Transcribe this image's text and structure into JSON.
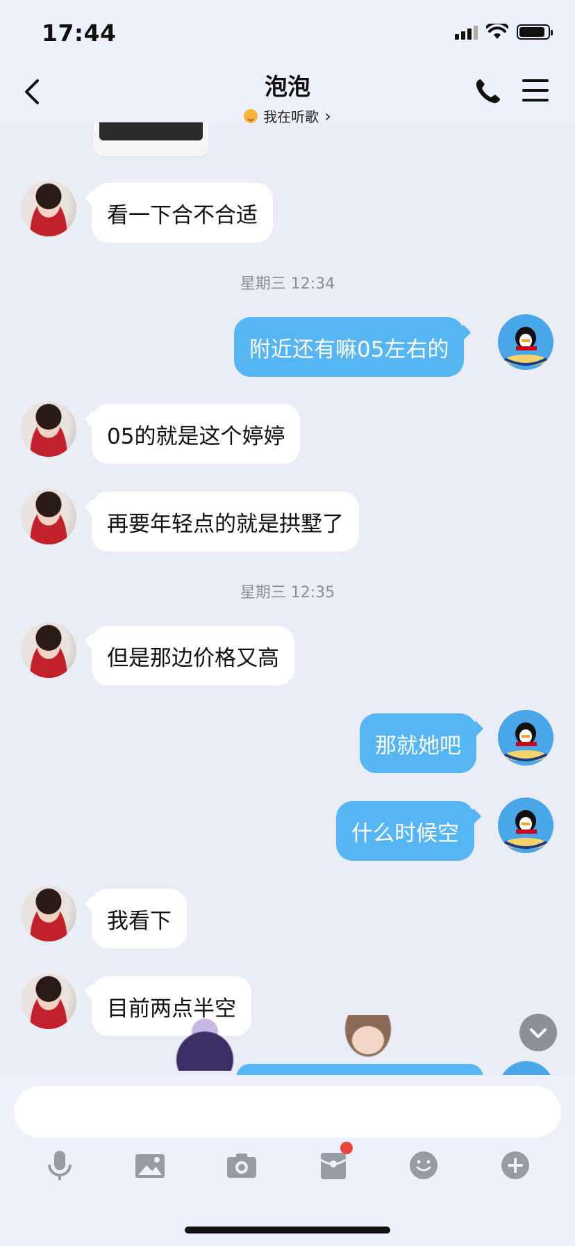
{
  "status_bar": {
    "time": "17:44"
  },
  "header": {
    "title": "泡泡",
    "status_text": "我在听歌",
    "chevron": "›"
  },
  "messages": [
    {
      "side": "in",
      "text": "看一下合不合适"
    },
    {
      "timestamp": "星期三 12:34"
    },
    {
      "side": "out",
      "text": "附近还有嘛05左右的"
    },
    {
      "side": "in",
      "text": "05的就是这个婷婷"
    },
    {
      "side": "in",
      "text": "再要年轻点的就是拱墅了"
    },
    {
      "timestamp": "星期三 12:35"
    },
    {
      "side": "in",
      "text": "但是那边价格又高"
    },
    {
      "side": "out",
      "text": "那就她吧"
    },
    {
      "side": "out",
      "text": "什么时候空"
    },
    {
      "side": "in",
      "text": "我看下"
    },
    {
      "side": "in",
      "text": "目前两点半空"
    }
  ],
  "input": {
    "value": "",
    "placeholder": ""
  },
  "toolbar": {
    "icons": [
      "microphone-icon",
      "image-icon",
      "camera-icon",
      "red-packet-icon",
      "emoji-icon",
      "plus-icon"
    ]
  },
  "colors": {
    "background": "#eaedf5",
    "outgoing_bubble": "#56b6f3",
    "incoming_bubble": "#ffffff",
    "badge": "#e8453c"
  }
}
